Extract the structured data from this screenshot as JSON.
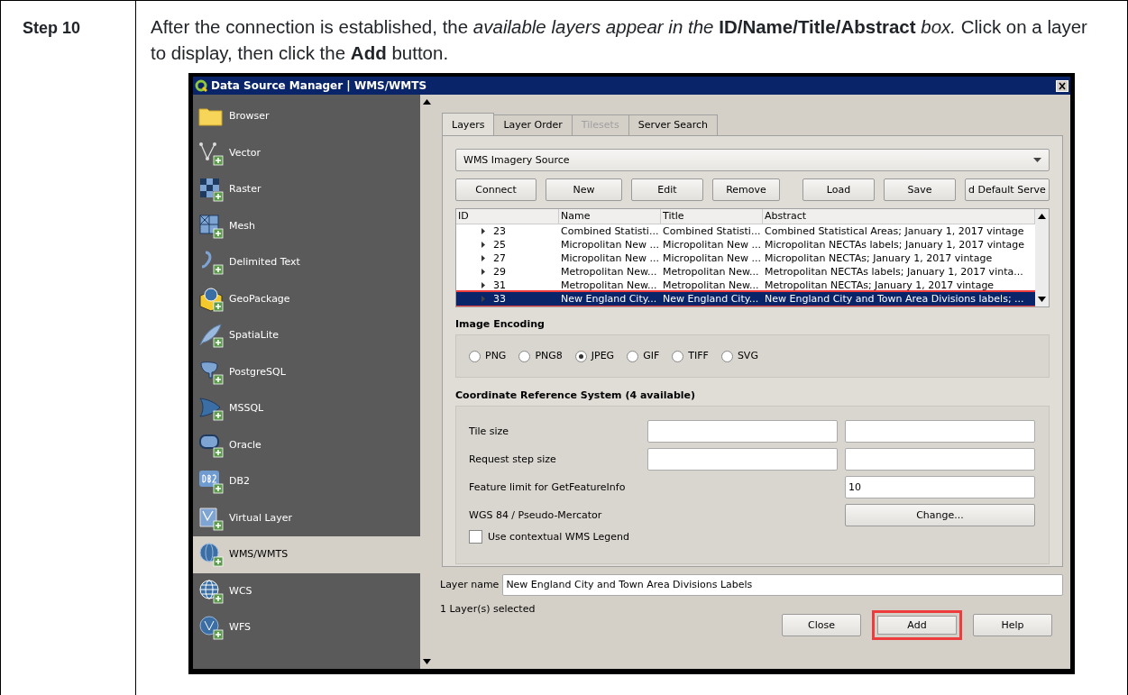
{
  "step": {
    "label": "Step 10",
    "instruction": "After the connection is established, the *available layers appear in the* **ID/Name/Title/Abstract** *box.* Click on a layer to display, then click the **Add** button."
  },
  "window": {
    "title": "Data Source Manager | WMS/WMTS",
    "sidebar": {
      "items": [
        {
          "label": "Browser",
          "selected": false
        },
        {
          "label": "Vector",
          "selected": false
        },
        {
          "label": "Raster",
          "selected": false
        },
        {
          "label": "Mesh",
          "selected": false
        },
        {
          "label": "Delimited Text",
          "selected": false
        },
        {
          "label": "GeoPackage",
          "selected": false
        },
        {
          "label": "SpatiaLite",
          "selected": false
        },
        {
          "label": "PostgreSQL",
          "selected": false
        },
        {
          "label": "MSSQL",
          "selected": false
        },
        {
          "label": "Oracle",
          "selected": false
        },
        {
          "label": "DB2",
          "selected": false
        },
        {
          "label": "Virtual Layer",
          "selected": false
        },
        {
          "label": "WMS/WMTS",
          "selected": true
        },
        {
          "label": "WCS",
          "selected": false
        },
        {
          "label": "WFS",
          "selected": false
        }
      ]
    },
    "tabs": [
      {
        "label": "Layers",
        "selected": true,
        "disabled": false
      },
      {
        "label": "Layer Order",
        "selected": false,
        "disabled": false
      },
      {
        "label": "Tilesets",
        "selected": false,
        "disabled": true
      },
      {
        "label": "Server Search",
        "selected": false,
        "disabled": false
      }
    ],
    "connection": {
      "value": "WMS Imagery Source"
    },
    "connection_buttons": [
      "Connect",
      "New",
      "Edit",
      "Remove",
      "Load",
      "Save",
      "d Default Serve"
    ],
    "layers": {
      "columns": [
        "ID",
        "Name",
        "Title",
        "Abstract"
      ],
      "rows": [
        {
          "id": "23",
          "name": "Combined Statisti...",
          "title": "Combined Statisti...",
          "abstract": "Combined Statistical Areas; January 1, 2017 vintage",
          "selected": false,
          "highlighted": false
        },
        {
          "id": "25",
          "name": "Micropolitan New ...",
          "title": "Micropolitan New ...",
          "abstract": "Micropolitan NECTAs labels; January 1, 2017 vintage",
          "selected": false,
          "highlighted": false
        },
        {
          "id": "27",
          "name": "Micropolitan New ...",
          "title": "Micropolitan New ...",
          "abstract": "Micropolitan NECTAs; January 1, 2017 vintage",
          "selected": false,
          "highlighted": false
        },
        {
          "id": "29",
          "name": "Metropolitan New...",
          "title": "Metropolitan New...",
          "abstract": "Metropolitan NECTAs labels; January 1, 2017 vinta...",
          "selected": false,
          "highlighted": false
        },
        {
          "id": "31",
          "name": "Metropolitan New...",
          "title": "Metropolitan New...",
          "abstract": "Metropolitan NECTAs; January 1, 2017 vintage",
          "selected": false,
          "highlighted": false
        },
        {
          "id": "33",
          "name": "New England City...",
          "title": "New England City...",
          "abstract": "New England City and Town Area Divisions labels; ...",
          "selected": true,
          "highlighted": true
        }
      ]
    },
    "image_encoding": {
      "title": "Image Encoding",
      "options": [
        {
          "label": "PNG",
          "selected": false
        },
        {
          "label": "PNG8",
          "selected": false
        },
        {
          "label": "JPEG",
          "selected": true
        },
        {
          "label": "GIF",
          "selected": false
        },
        {
          "label": "TIFF",
          "selected": false
        },
        {
          "label": "SVG",
          "selected": false
        }
      ]
    },
    "crs": {
      "title": "Coordinate Reference System (4 available)",
      "rows": [
        {
          "kind": "pair",
          "label": "Tile size"
        },
        {
          "kind": "pair",
          "label": "Request step size"
        },
        {
          "kind": "single",
          "label": "Feature limit for GetFeatureInfo",
          "value": "10"
        },
        {
          "kind": "button",
          "label": "WGS 84 / Pseudo-Mercator",
          "button": "Change..."
        }
      ],
      "legend_checkbox": {
        "label": "Use contextual WMS Legend",
        "checked": false
      }
    },
    "layer_name": {
      "label": "Layer name",
      "value": "New England City and Town Area  Divisions Labels"
    },
    "status": "1 Layer(s) selected",
    "footer_buttons": [
      {
        "label": "Close",
        "highlighted": false
      },
      {
        "label": "Add",
        "highlighted": true
      },
      {
        "label": "Help",
        "highlighted": false
      }
    ]
  }
}
